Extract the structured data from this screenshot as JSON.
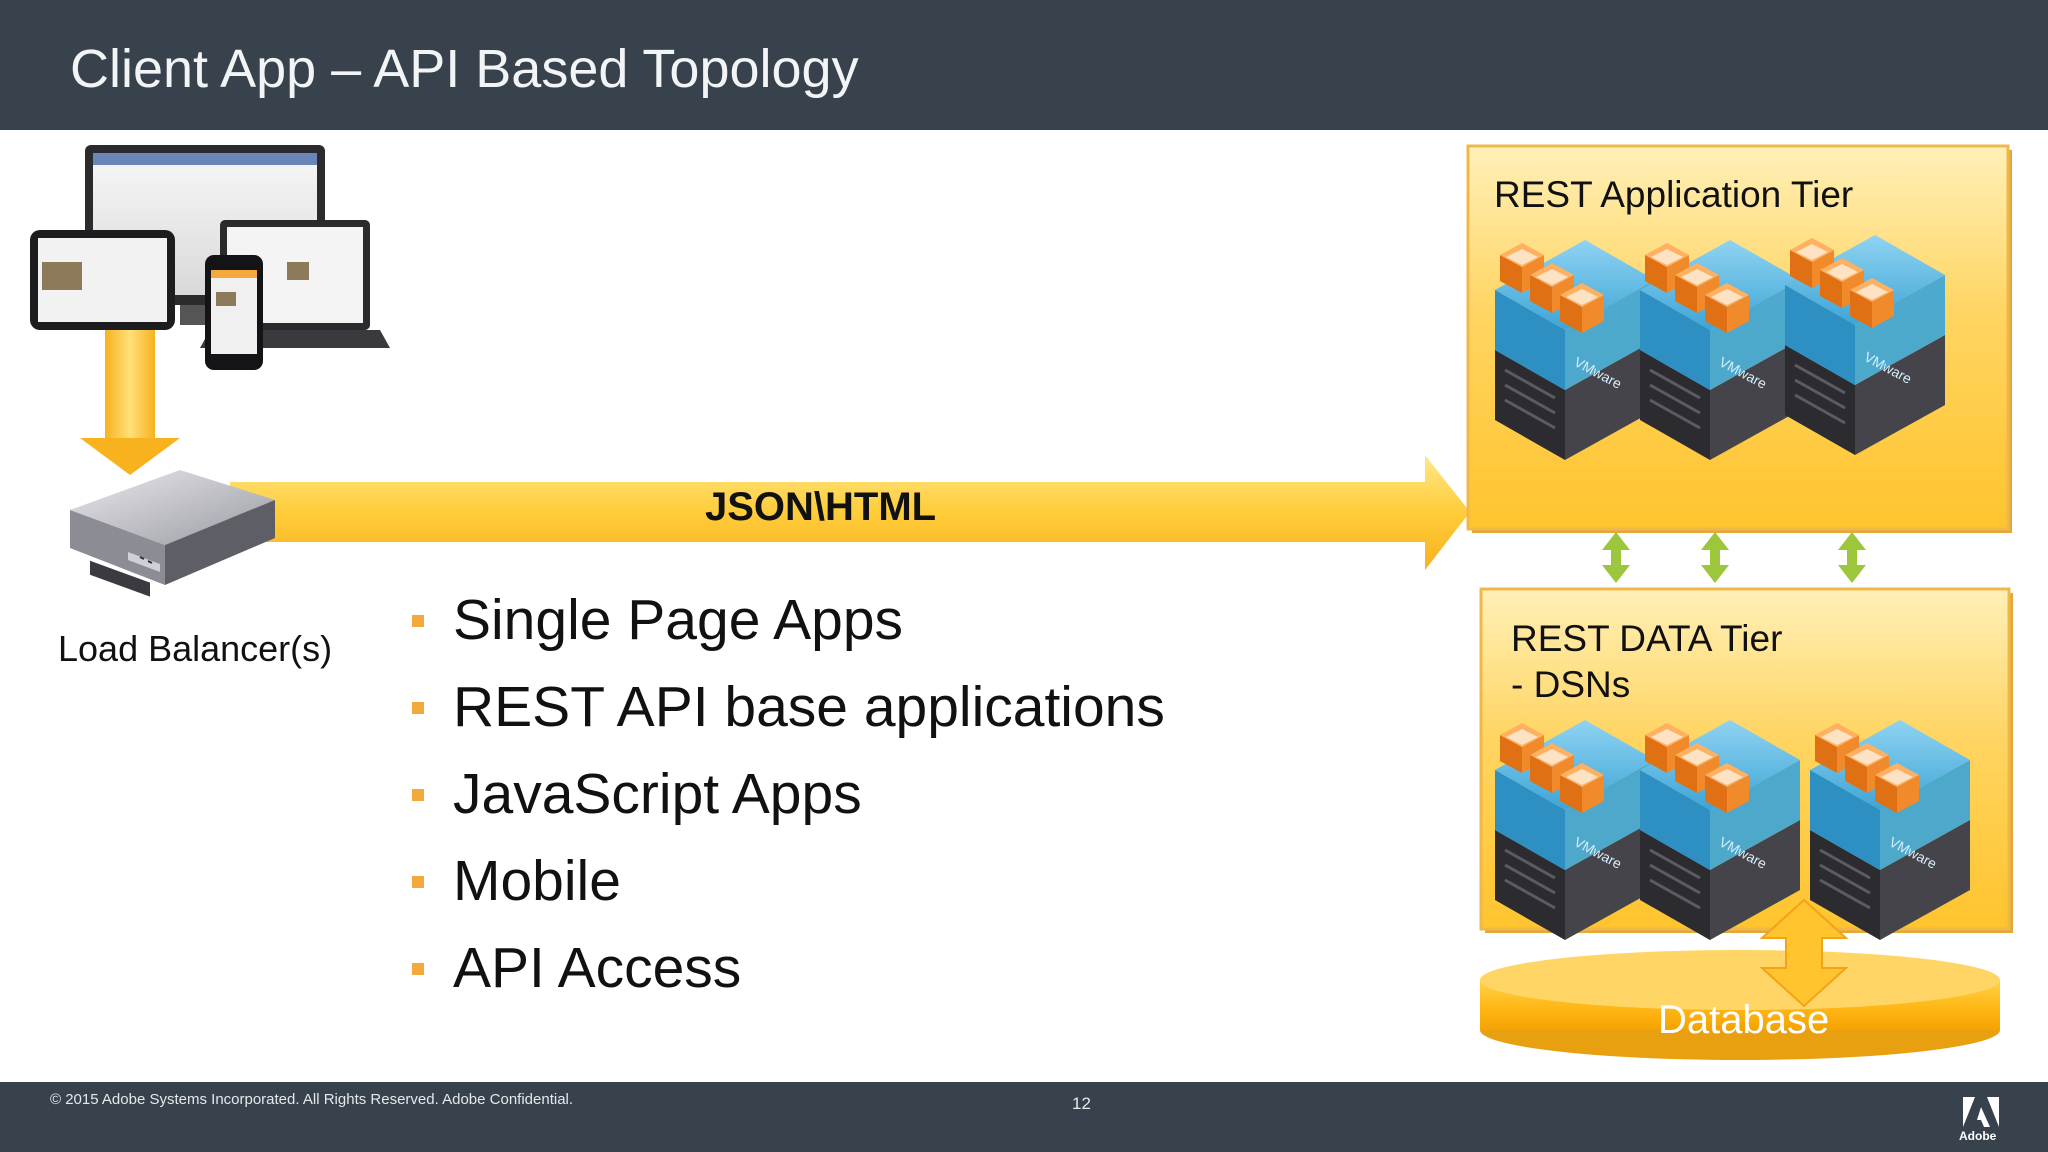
{
  "slide": {
    "title": "Client App – API Based Topology",
    "page_number": "12",
    "copyright": "© 2015 Adobe Systems Incorporated.  All Rights Reserved.  Adobe Confidential.",
    "logo_text": "Adobe"
  },
  "diagram": {
    "load_balancer_label": "Load Balancer(s)",
    "flow_label": "JSON\\HTML",
    "app_tier_label": "REST Application Tier",
    "data_tier_label_line1": "REST DATA Tier",
    "data_tier_label_line2": "- DSNs",
    "database_label": "Database",
    "server_brand": "VMware"
  },
  "bullets": [
    "Single Page Apps",
    "REST API base applications",
    "JavaScript Apps",
    "Mobile",
    "API Access"
  ],
  "colors": {
    "header_bg": "#37424d",
    "accent_orange": "#f3a93b",
    "tier_fill": "#ffd15c",
    "connector_green": "#9cc63c",
    "server_blue": "#3ea5d6"
  }
}
